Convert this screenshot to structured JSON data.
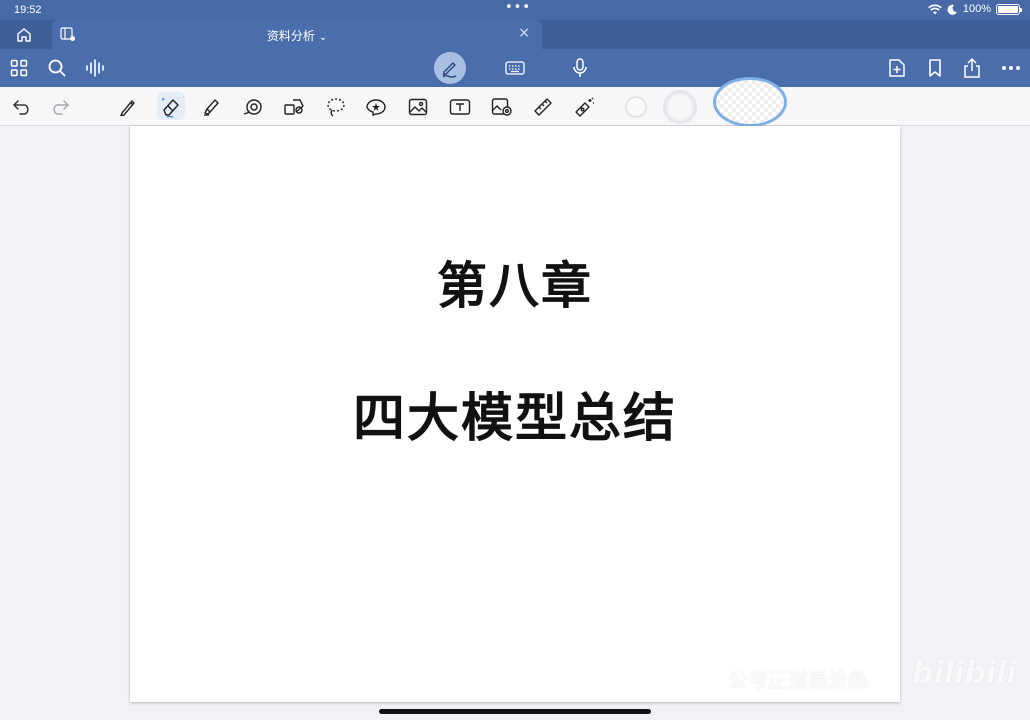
{
  "status_bar": {
    "time": "19:52",
    "multitask_dots": "•••",
    "battery_percent": "100%",
    "battery_level": 1.0
  },
  "tab_bar": {
    "document_title": "资料分析",
    "close_glyph": "×"
  },
  "toolbar": {
    "icons": [
      "grid-icon",
      "search-icon",
      "audio-waveform-icon",
      "pen-mode-icon",
      "keyboard-icon",
      "microphone-icon",
      "add-page-icon",
      "bookmark-icon",
      "share-icon",
      "more-icon"
    ]
  },
  "tools": {
    "items": [
      "undo-icon",
      "redo-icon",
      "pen-icon",
      "eraser-icon",
      "highlighter-icon",
      "shape-icon",
      "element-icon",
      "lasso-icon",
      "sticker-icon",
      "image-icon",
      "text-icon",
      "camera-icon",
      "ruler-icon",
      "laser-pointer-icon"
    ],
    "selected": "eraser-icon"
  },
  "page": {
    "chapter_title": "第八章",
    "subtitle": "四大模型总结"
  },
  "watermark": {
    "text": "公考正道是沧桑",
    "logo": "bilibili"
  },
  "colors": {
    "status_bar": "#4769a6",
    "toolbar": "#4a6dac",
    "tab_bar": "#3f5f99",
    "selection_ring": "#7fb0e6"
  }
}
